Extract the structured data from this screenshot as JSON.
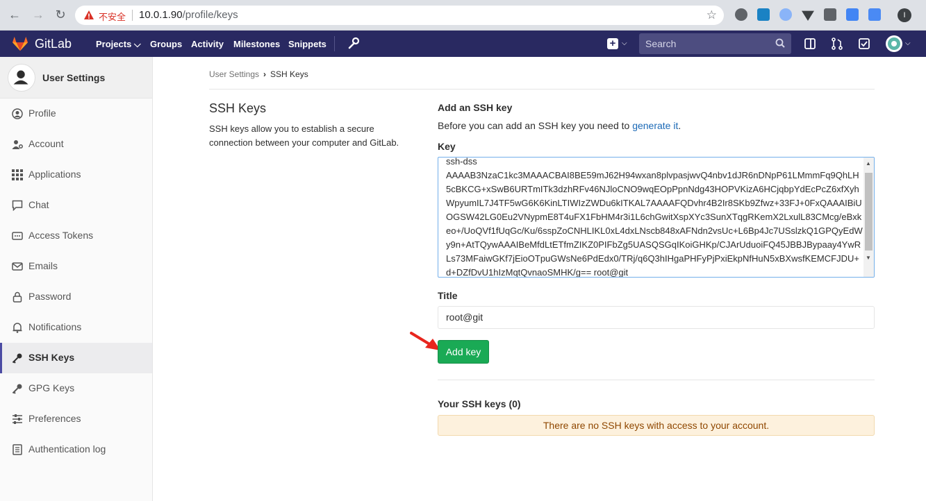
{
  "browser": {
    "insecure_label": "不安全",
    "url_host": "10.0.1.90",
    "url_path": "/profile/keys",
    "profile_initial": "I"
  },
  "header": {
    "brand": "GitLab",
    "nav": [
      "Projects",
      "Groups",
      "Activity",
      "Milestones",
      "Snippets"
    ],
    "search_placeholder": "Search",
    "color": "#292961"
  },
  "sidebar": {
    "title": "User Settings",
    "items": [
      {
        "label": "Profile",
        "icon": "profile-icon"
      },
      {
        "label": "Account",
        "icon": "account-icon"
      },
      {
        "label": "Applications",
        "icon": "applications-icon"
      },
      {
        "label": "Chat",
        "icon": "chat-icon"
      },
      {
        "label": "Access Tokens",
        "icon": "access-tokens-icon"
      },
      {
        "label": "Emails",
        "icon": "email-icon"
      },
      {
        "label": "Password",
        "icon": "lock-icon"
      },
      {
        "label": "Notifications",
        "icon": "bell-icon"
      },
      {
        "label": "SSH Keys",
        "icon": "key-icon",
        "active": true
      },
      {
        "label": "GPG Keys",
        "icon": "key-icon"
      },
      {
        "label": "Preferences",
        "icon": "sliders-icon"
      },
      {
        "label": "Authentication log",
        "icon": "log-icon"
      }
    ]
  },
  "breadcrumb": {
    "parent": "User Settings",
    "current": "SSH Keys"
  },
  "section": {
    "title": "SSH Keys",
    "description": "SSH keys allow you to establish a secure connection between your computer and GitLab."
  },
  "form": {
    "add_title": "Add an SSH key",
    "add_desc_prefix": "Before you can add an SSH key you need to ",
    "add_desc_link": "generate it",
    "add_desc_suffix": ".",
    "key_label": "Key",
    "key_value": "ssh-dss\nAAAAB3NzaC1kc3MAAACBAI8BE59mJ62H94wxan8plvpasjwvQ4nbv1dJR6nDNpP61LMmmFq9QhLH5cBKCG+xSwB6URTmITk3dzhRFv46NJloCNO9wqEOpPpnNdg43HOPVKizA6HCjqbpYdEcPcZ6xfXyhWpyumIL7J4TF5wG6K6KinLTIWIzZWDu6kITKAL7AAAAFQDvhr4B2Ir8SKb9Zfwz+33FJ+0FxQAAAIBiUOGSW42LG0Eu2VNypmE8T4uFX1FbHM4r3i1L6chGwitXspXYc3SunXTqgRKemX2LxulL83CMcg/eBxkeo+/UoQVf1fUqGc/Ku/6sspZoCNHLIKL0xL4dxLNscb848xAFNdn2vsUc+L6Bp4Jc7USslzkQ1GPQyEdWy9n+AtTQywAAAIBeMfdLtETfmZIKZ0PIFbZg5UASQSGqIKoiGHKp/CJArUduoiFQ45JBBJBypaay4YwRLs73MFaiwGKf7jEioOTpuGWsNe6PdEdx0/TRj/q6Q3hIHgaPHFyPjPxiEkpNfHuN5xBXwsfKEMCFJDU+d+DZfDvU1hIzMqtQvnaoSMHK/g== root@git",
    "title_label": "Title",
    "title_value": "root@git",
    "add_button": "Add key"
  },
  "keys": {
    "heading": "Your SSH keys (0)",
    "empty_message": "There are no SSH keys with access to your account."
  }
}
